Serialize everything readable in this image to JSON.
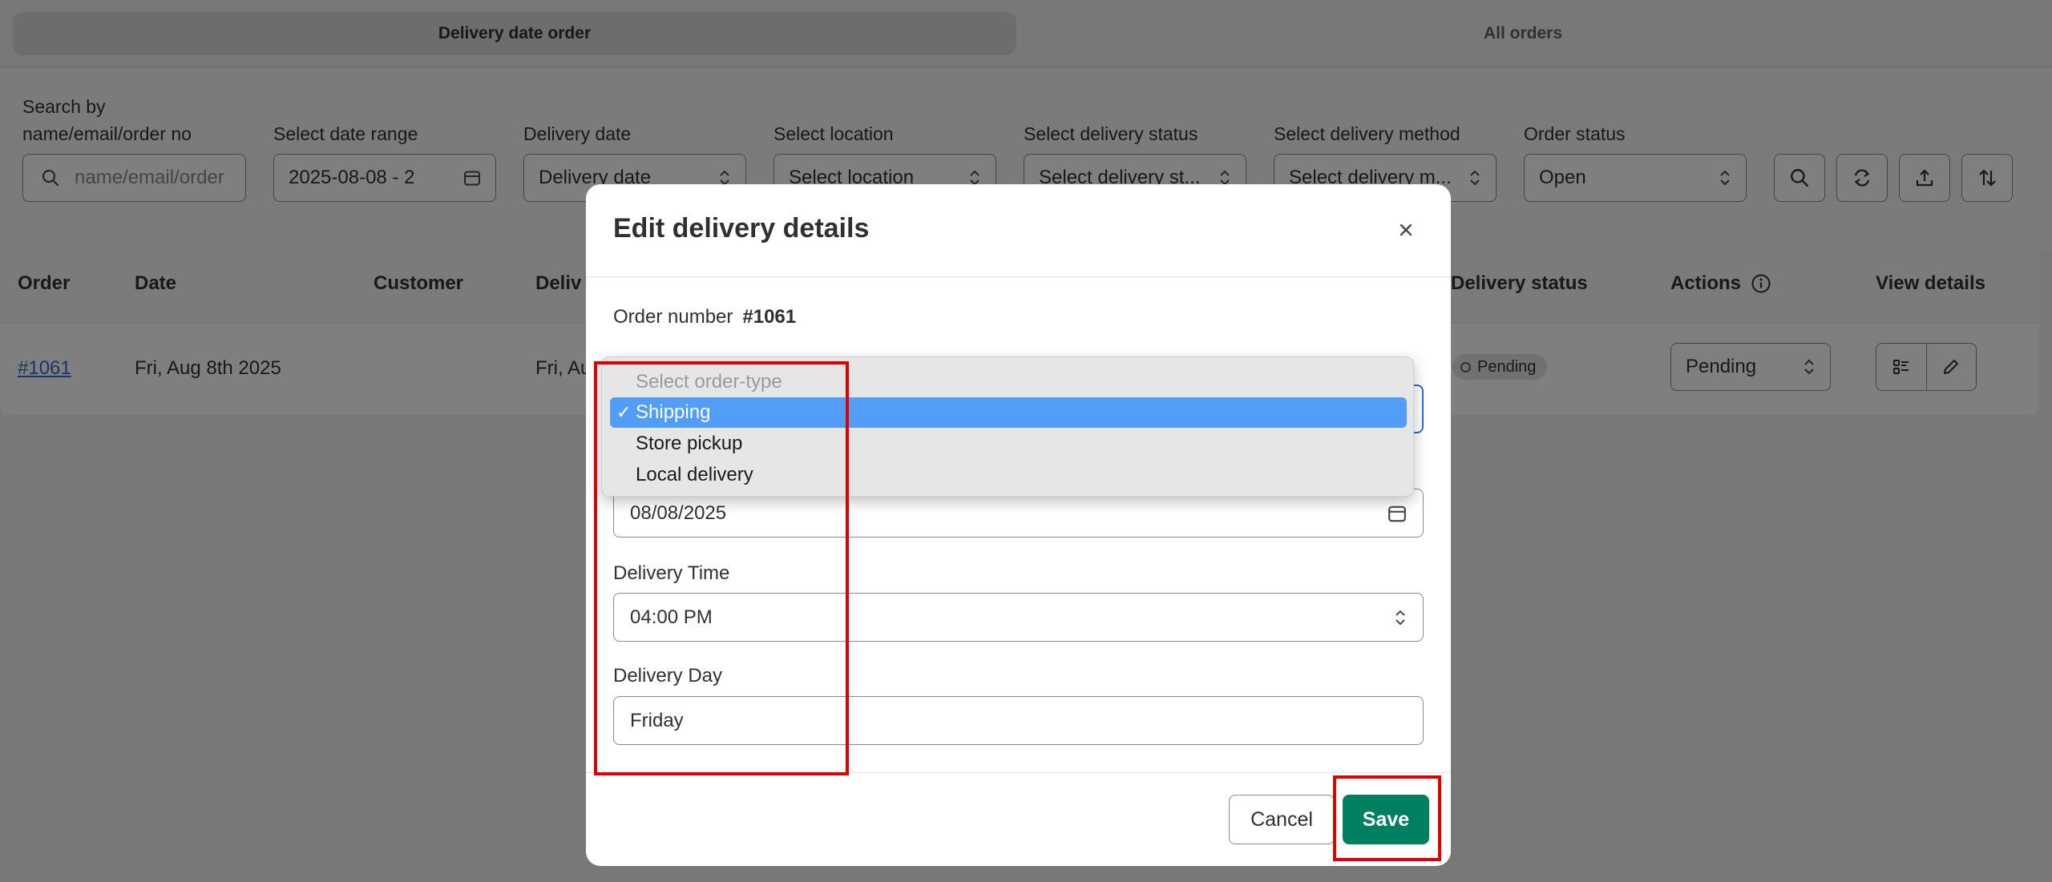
{
  "tabs": [
    {
      "label": "Delivery date order",
      "active": true
    },
    {
      "label": "All orders",
      "active": false
    }
  ],
  "filters": {
    "search_label_line1": "Search by",
    "search_label_line2": "name/email/order no",
    "search_placeholder": "name/email/order",
    "date_range_label": "Select date range",
    "date_range_value": "2025-08-08 - 2",
    "delivery_date_label": "Delivery date",
    "delivery_date_value": "Delivery date",
    "location_label": "Select location",
    "location_value": "Select location",
    "delivery_status_label": "Select delivery status",
    "delivery_status_value": "Select delivery st...",
    "delivery_method_label": "Select delivery method",
    "delivery_method_value": "Select delivery m...",
    "order_status_label": "Order status",
    "order_status_value": "Open"
  },
  "table": {
    "headers": {
      "order": "Order",
      "date": "Date",
      "customer": "Customer",
      "delivery": "Deliv",
      "delivery_status": "Delivery status",
      "actions": "Actions",
      "view_details": "View details"
    },
    "row": {
      "order": "#1061",
      "date": "Fri, Aug 8th 2025",
      "delivery": "Fri, Au",
      "status": "Pending",
      "action_value": "Pending"
    }
  },
  "modal": {
    "title": "Edit delivery details",
    "order_number_label": "Order number",
    "order_number": "#1061",
    "date_value": "08/08/2025",
    "delivery_time_label": "Delivery Time",
    "delivery_time_value": "04:00 PM",
    "delivery_day_label": "Delivery Day",
    "delivery_day_value": "Friday",
    "cancel_label": "Cancel",
    "save_label": "Save"
  },
  "dropdown": {
    "options": [
      {
        "label": "Select order-type",
        "disabled": true
      },
      {
        "label": "Shipping",
        "selected": true,
        "check": "✓"
      },
      {
        "label": "Store pickup"
      },
      {
        "label": "Local delivery"
      }
    ]
  },
  "colors": {
    "primary": "#008060",
    "selection": "#529df5",
    "annotation": "#e00000",
    "link": "#2c6ecb"
  }
}
